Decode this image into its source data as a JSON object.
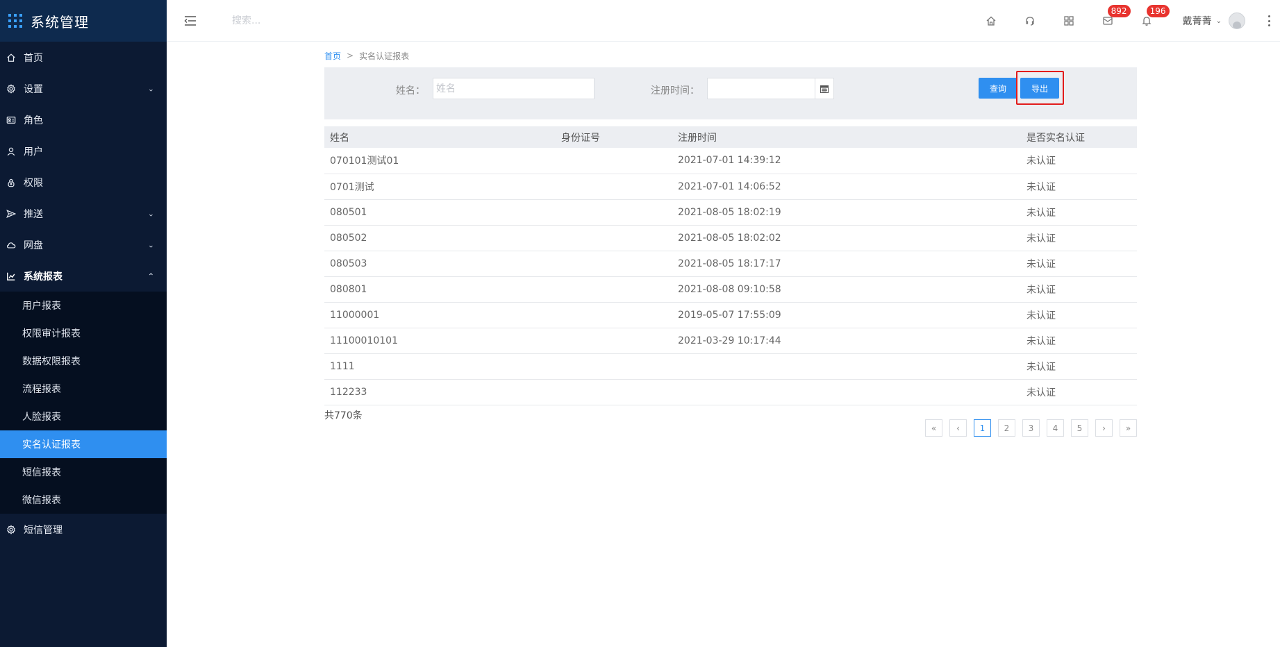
{
  "sidebar": {
    "brand_title": "系统管理",
    "items": [
      {
        "label": "首页",
        "icon": "home-icon"
      },
      {
        "label": "设置",
        "icon": "settings-icon",
        "chevron": "⌄"
      },
      {
        "label": "角色",
        "icon": "id-card-icon"
      },
      {
        "label": "用户",
        "icon": "user-icon"
      },
      {
        "label": "权限",
        "icon": "lock-icon"
      },
      {
        "label": "推送",
        "icon": "send-icon",
        "chevron": "⌄"
      },
      {
        "label": "网盘",
        "icon": "cloud-icon",
        "chevron": "⌄"
      },
      {
        "label": "系统报表",
        "icon": "chart-icon",
        "chevron": "⌃"
      }
    ],
    "subitems": [
      "用户报表",
      "权限审计报表",
      "数据权限报表",
      "流程报表",
      "人脸报表",
      "实名认证报表",
      "短信报表",
      "微信报表"
    ],
    "selected_subitem": "实名认证报表",
    "after": {
      "label": "短信管理",
      "icon": "settings-icon"
    }
  },
  "header": {
    "search_placeholder": "搜索...",
    "badges": {
      "messages": "892",
      "notifications": "196"
    },
    "user_name": "戴菁菁"
  },
  "breadcrumb": {
    "home": "首页",
    "separator": ">",
    "current": "实名认证报表"
  },
  "filter": {
    "name_label": "姓名：",
    "name_placeholder": "姓名",
    "name_value": "",
    "time_label": "注册时间：",
    "time_value": "",
    "query_label": "查询",
    "export_label": "导出"
  },
  "table": {
    "columns": [
      "姓名",
      "身份证号",
      "注册时间",
      "是否实名认证"
    ],
    "rows": [
      [
        "070101测试01",
        "",
        "2021-07-01 14:39:12",
        "未认证"
      ],
      [
        "0701测试",
        "",
        "2021-07-01 14:06:52",
        "未认证"
      ],
      [
        "080501",
        "",
        "2021-08-05 18:02:19",
        "未认证"
      ],
      [
        "080502",
        "",
        "2021-08-05 18:02:02",
        "未认证"
      ],
      [
        "080503",
        "",
        "2021-08-05 18:17:17",
        "未认证"
      ],
      [
        "080801",
        "",
        "2021-08-08 09:10:58",
        "未认证"
      ],
      [
        "11000001",
        "",
        "2019-05-07 17:55:09",
        "未认证"
      ],
      [
        "11100010101",
        "",
        "2021-03-29 10:17:44",
        "未认证"
      ],
      [
        "1111",
        "",
        "",
        "未认证"
      ],
      [
        "112233",
        "",
        "",
        "未认证"
      ]
    ]
  },
  "total_text": "共770条",
  "pagination": {
    "first": "«",
    "prev": "‹",
    "pages": [
      "1",
      "2",
      "3",
      "4",
      "5"
    ],
    "current": "1",
    "next": "›",
    "last": "»"
  },
  "colors": {
    "sidebar_bg": "#0c1a33",
    "accent": "#2f8ff0",
    "badge": "#e8332e",
    "highlight": "#e21b1b"
  }
}
